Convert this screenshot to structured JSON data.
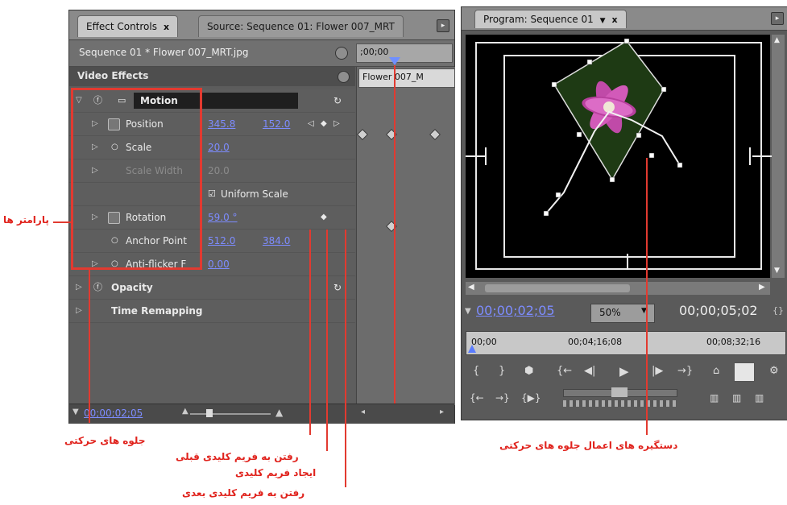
{
  "left_tabs": {
    "effect_controls": "Effect Controls",
    "effect_close": "x",
    "source": "Source: Sequence 01: Flower 007_MRT"
  },
  "header": {
    "clip_name": "Sequence 01 * Flower 007_MRT.jpg",
    "timecode_small": ";00;00",
    "timeline_clip": "Flower 007_M"
  },
  "video_effects_label": "Video Effects",
  "effects": {
    "motion": "Motion",
    "position_label": "Position",
    "position_x": "345.8",
    "position_y": "152.0",
    "scale_label": "Scale",
    "scale_value": "20.0",
    "scale_width_label": "Scale Width",
    "scale_width_value": "20.0",
    "uniform_scale": "Uniform Scale",
    "rotation_label": "Rotation",
    "rotation_value": "59.0 °",
    "anchor_label": "Anchor Point",
    "anchor_x": "512.0",
    "anchor_y": "384.0",
    "antiflicker_label": "Anti-flicker F",
    "antiflicker_value": "0.00",
    "opacity": "Opacity",
    "time_remapping": "Time Remapping"
  },
  "footer_time": "00;00;02;05",
  "program": {
    "tab": "Program: Sequence 01",
    "tab_close": "x",
    "current_time": "00;00;02;05",
    "zoom": "50%",
    "duration": "00;00;05;02",
    "ruler_start": "00;00",
    "ruler_mid": "00;04;16;08",
    "ruler_end": "00;08;32;16"
  },
  "annotations": {
    "parameters": "پارامتر ها",
    "motion_effects": "جلوه های حرکتی",
    "prev_keyframe": "رفتن به فریم کلیدی قبلی",
    "add_keyframe": "ایجاد فریم کلیدی",
    "next_keyframe": "رفتن به فریم کلیدی بعدی",
    "motion_handles": "دستگیره های اعمال جلوه های حرکتی"
  },
  "colors": {
    "accent_red": "#e0221c",
    "value_blue": "#7d8cff",
    "panel_gray": "#5c5c5c"
  }
}
